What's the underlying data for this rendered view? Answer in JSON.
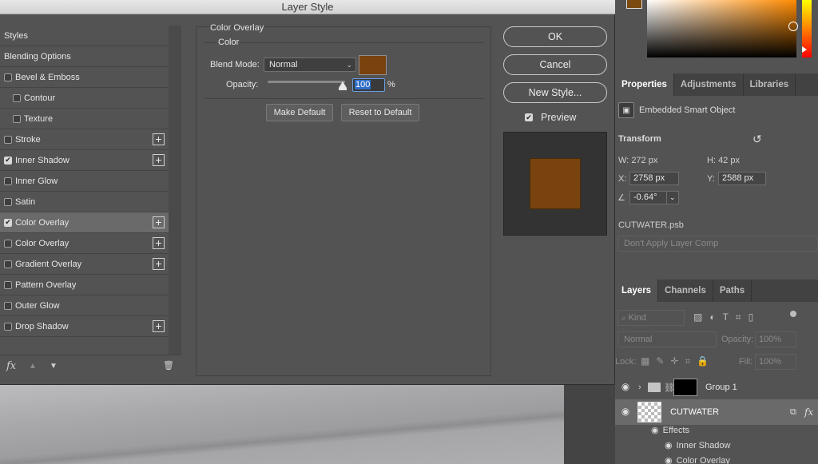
{
  "dialog": {
    "title": "Layer Style",
    "styles_list": [
      {
        "label": "Styles",
        "type": "heading"
      },
      {
        "label": "Blending Options",
        "type": "heading"
      },
      {
        "label": "Bevel & Emboss",
        "checked": false,
        "plus": false,
        "indent": 0
      },
      {
        "label": "Contour",
        "checked": false,
        "plus": false,
        "indent": 1
      },
      {
        "label": "Texture",
        "checked": false,
        "plus": false,
        "indent": 1
      },
      {
        "label": "Stroke",
        "checked": false,
        "plus": true,
        "indent": 0
      },
      {
        "label": "Inner Shadow",
        "checked": true,
        "plus": true,
        "indent": 0
      },
      {
        "label": "Inner Glow",
        "checked": false,
        "plus": false,
        "indent": 0
      },
      {
        "label": "Satin",
        "checked": false,
        "plus": false,
        "indent": 0
      },
      {
        "label": "Color Overlay",
        "checked": true,
        "plus": true,
        "indent": 0,
        "selected": true
      },
      {
        "label": "Color Overlay",
        "checked": false,
        "plus": true,
        "indent": 0
      },
      {
        "label": "Gradient Overlay",
        "checked": false,
        "plus": true,
        "indent": 0
      },
      {
        "label": "Pattern Overlay",
        "checked": false,
        "plus": false,
        "indent": 0
      },
      {
        "label": "Outer Glow",
        "checked": false,
        "plus": false,
        "indent": 0
      },
      {
        "label": "Drop Shadow",
        "checked": false,
        "plus": true,
        "indent": 0
      }
    ],
    "bottom_icons": {
      "fx": "fx",
      "up": "▲",
      "down": "▼",
      "trash": "🗑"
    },
    "panel": {
      "section_title": "Color Overlay",
      "group_title": "Color",
      "blend_mode_label": "Blend Mode:",
      "blend_mode_value": "Normal",
      "overlay_color": "#78430e",
      "opacity_label": "Opacity:",
      "opacity_value": "100",
      "opacity_unit": "%",
      "opacity_level_percent": 100,
      "make_default": "Make Default",
      "reset_default": "Reset to Default"
    },
    "buttons": {
      "ok": "OK",
      "cancel": "Cancel",
      "new_style": "New Style..."
    },
    "preview": {
      "label": "Preview",
      "checked": true
    }
  },
  "properties": {
    "tabs": [
      "Properties",
      "Adjustments",
      "Libraries"
    ],
    "active_tab": "Properties",
    "object_type": "Embedded Smart Object",
    "transform_title": "Transform",
    "w_label": "W:",
    "w_value": "272 px",
    "h_label": "H:",
    "h_value": "42 px",
    "x_label": "X:",
    "x_value": "2758 px",
    "y_label": "Y:",
    "y_value": "2588 px",
    "angle_value": "-0.64°",
    "file_name": "CUTWATER.psb",
    "layer_comp": "Don't Apply Layer Comp"
  },
  "layers": {
    "tabs": [
      "Layers",
      "Channels",
      "Paths"
    ],
    "active_tab": "Layers",
    "filter_placeholder": "Kind",
    "blend_mode": "Normal",
    "opacity_label": "Opacity:",
    "opacity_value": "100%",
    "lock_label": "Lock:",
    "fill_label": "Fill:",
    "fill_value": "100%",
    "items": {
      "group_name": "Group 1",
      "layer_name": "CUTWATER",
      "effects_label": "Effects",
      "effect_1": "Inner Shadow",
      "effect_2": "Color Overlay"
    }
  },
  "colors": {
    "foreground": "#7a4a10",
    "selection_highlight": "#2f6fc8"
  }
}
